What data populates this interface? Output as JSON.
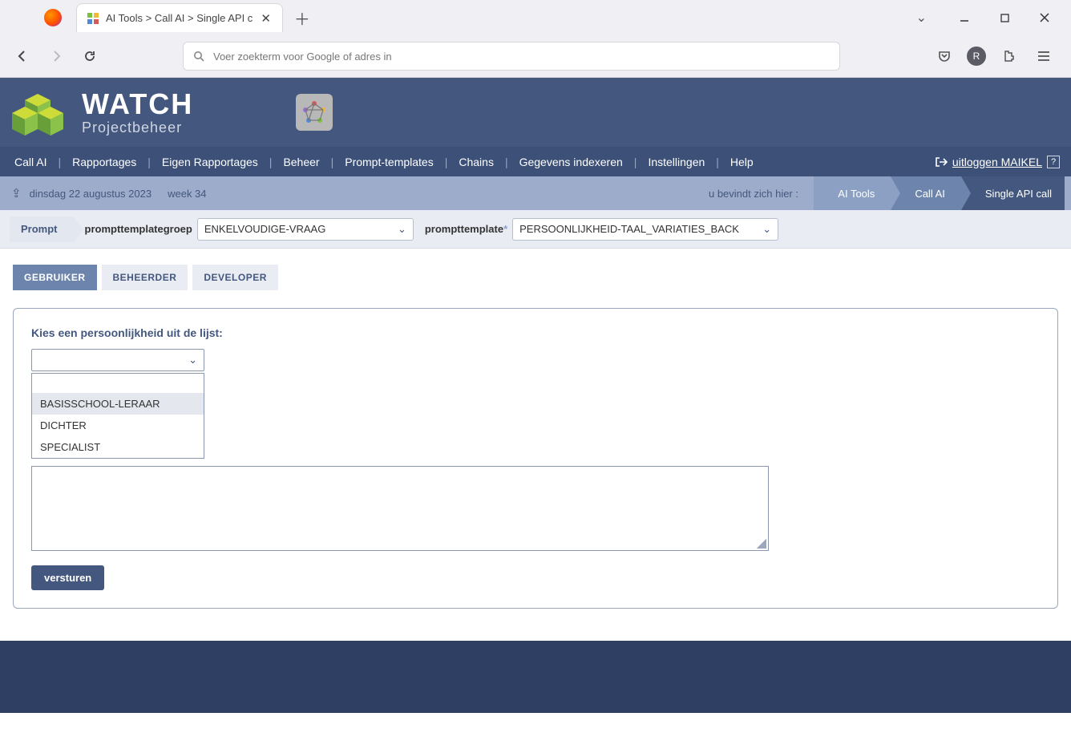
{
  "browser": {
    "tab_title": "AI Tools > Call AI > Single API c",
    "omnibox_placeholder": "Voer zoekterm voor Google of adres in",
    "avatar_letter": "R"
  },
  "brand": {
    "name": "WATCH",
    "subtitle": "Projectbeheer"
  },
  "mainnav": {
    "items": [
      "Call AI",
      "Rapportages",
      "Eigen Rapportages",
      "Beheer",
      "Prompt-templates",
      "Chains",
      "Gegevens indexeren",
      "Instellingen",
      "Help"
    ],
    "logout_label": "uitloggen MAIKEL"
  },
  "locbar": {
    "date_text": "dinsdag 22 augustus 2023",
    "week_text": "week 34",
    "you_are_here": "u bevindt zich hier :",
    "crumbs": [
      "AI Tools",
      "Call AI",
      "Single API call"
    ]
  },
  "localsteps": {
    "step_label": "Prompt",
    "group_label": "prompttemplategroep",
    "group_value": "ENKELVOUDIGE-VRAAG",
    "template_label": "prompttemplate",
    "template_required_marker": "*",
    "template_value": "PERSOONLIJKHEID-TAAL_VARIATIES_BACK"
  },
  "tabs": {
    "items": [
      "GEBRUIKER",
      "BEHEERDER",
      "DEVELOPER"
    ],
    "active_index": 0
  },
  "form": {
    "field_label": "Kies een persoonlijkheid uit de lijst:",
    "dropdown_options": [
      "",
      "BASISSCHOOL-LERAAR",
      "DICHTER",
      "SPECIALIST"
    ],
    "highlighted_option_index": 1,
    "submit_label": "versturen"
  }
}
